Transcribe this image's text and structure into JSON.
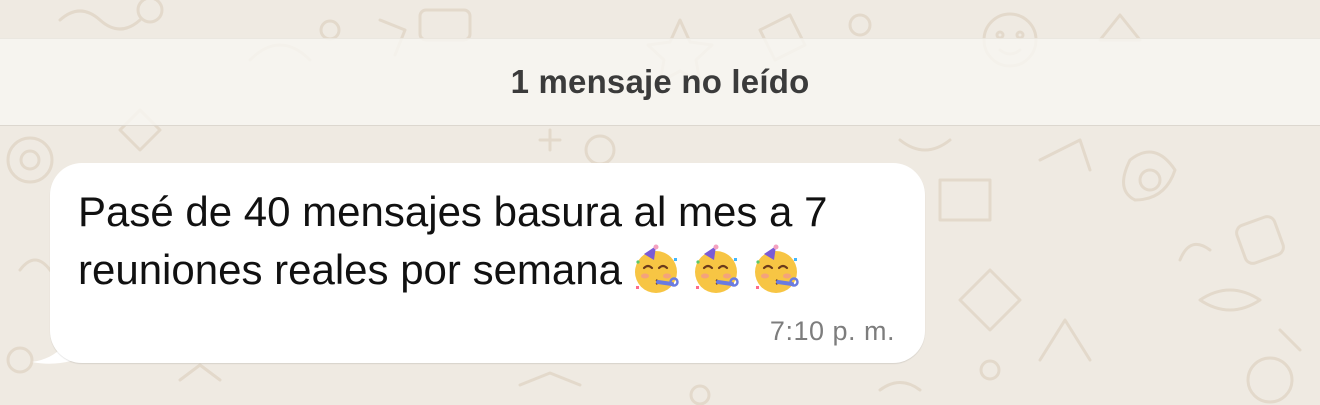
{
  "colors": {
    "wallpaper": "#efeae2",
    "doodle": "#e6ddd0",
    "bubble": "#ffffff",
    "banner_text": "#3b3b3b",
    "message_text": "#111111",
    "timestamp": "#7d7d7d"
  },
  "unread_banner": {
    "text": "1 mensaje no leído"
  },
  "message": {
    "line1": "Pasé de 40 mensajes basura al mes a 7",
    "line2": "reuniones reales por semana",
    "emojis": [
      "partying-face-icon",
      "partying-face-icon",
      "partying-face-icon"
    ],
    "time": "7:10 p. m."
  }
}
